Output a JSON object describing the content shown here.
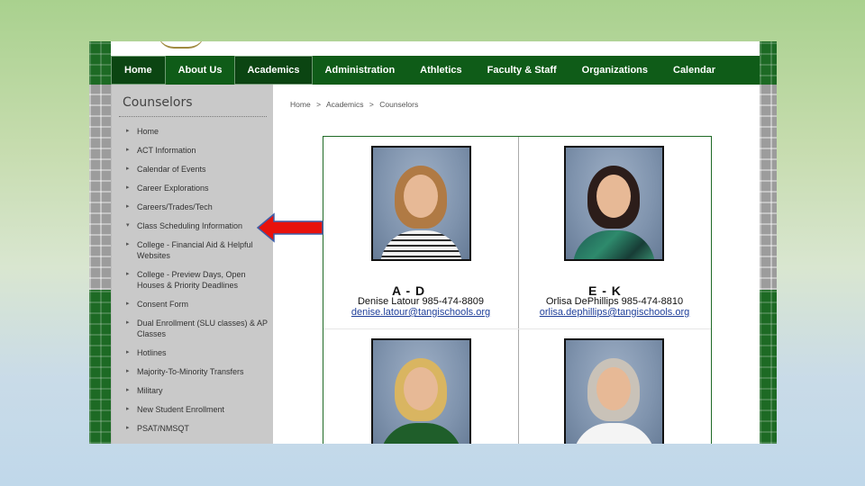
{
  "nav": {
    "items": [
      {
        "label": "Home"
      },
      {
        "label": "About Us"
      },
      {
        "label": "Academics"
      },
      {
        "label": "Administration"
      },
      {
        "label": "Athletics"
      },
      {
        "label": "Faculty & Staff"
      },
      {
        "label": "Organizations"
      },
      {
        "label": "Calendar"
      }
    ],
    "active": "Academics"
  },
  "sidebar": {
    "title": "Counselors",
    "items": [
      {
        "label": "Home"
      },
      {
        "label": "ACT Information"
      },
      {
        "label": "Calendar of Events"
      },
      {
        "label": "Career Explorations"
      },
      {
        "label": "Careers/Trades/Tech"
      },
      {
        "label": "Class Scheduling Information"
      },
      {
        "label": "College - Financial Aid & Helpful Websites"
      },
      {
        "label": "College - Preview Days, Open Houses & Priority Deadlines"
      },
      {
        "label": "Consent Form"
      },
      {
        "label": "Dual Enrollment (SLU classes) & AP Classes"
      },
      {
        "label": "Hotlines"
      },
      {
        "label": "Majority-To-Minority Transfers"
      },
      {
        "label": "Military"
      },
      {
        "label": "New Student Enrollment"
      },
      {
        "label": "PSAT/NMSQT"
      }
    ]
  },
  "breadcrumb": [
    "Home",
    ">",
    "Academics",
    ">",
    "Counselors"
  ],
  "counselors": [
    {
      "range": "A - D",
      "name": "Denise Latour 985-474-8809",
      "email": "denise.latour@tangischools.org"
    },
    {
      "range": "E - K",
      "name": "Orlisa DePhillips 985-474-8810",
      "email": "orlisa.dephillips@tangischools.org"
    }
  ],
  "colors": {
    "nav_green": "#0f5c18",
    "arrow_red": "#e8120c",
    "arrow_outline": "#3e5ea8"
  }
}
